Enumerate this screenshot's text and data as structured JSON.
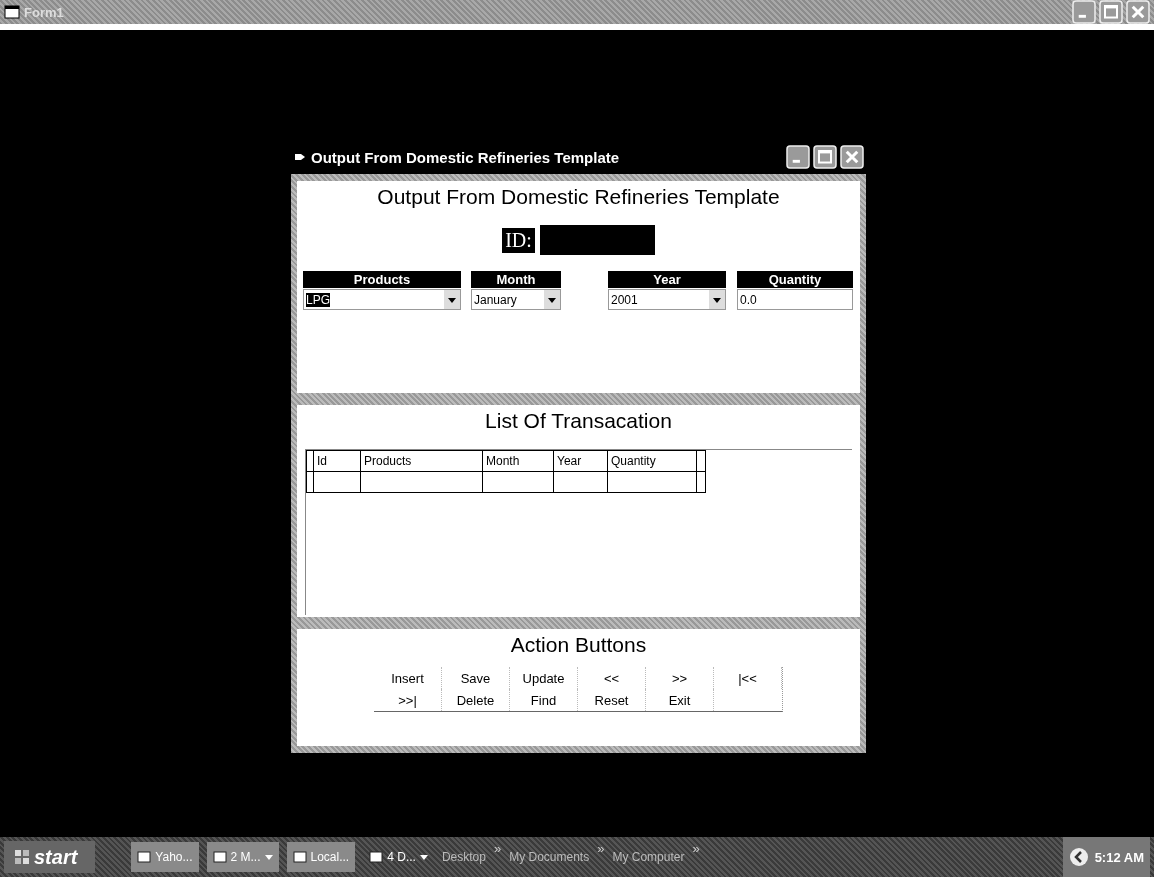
{
  "outer_window": {
    "title": "Form1"
  },
  "window": {
    "title": "Output From Domestic Refineries Template"
  },
  "header": {
    "title": "Output From Domestic Refineries Template",
    "id_label": "ID:"
  },
  "fields": [
    {
      "label": "Products",
      "value": "LPG",
      "kind": "dropdown",
      "text_selected": true
    },
    {
      "label": "Month",
      "value": "January",
      "kind": "dropdown",
      "text_selected": false
    },
    {
      "label": "Year",
      "value": "2001",
      "kind": "dropdown",
      "text_selected": false
    },
    {
      "label": "Quantity",
      "value": "0.0",
      "kind": "textbox",
      "text_selected": false
    }
  ],
  "list": {
    "title": "List Of Transacation",
    "columns": [
      "Id",
      "Products",
      "Month",
      "Year",
      "Quantity"
    ]
  },
  "actions": {
    "title": "Action Buttons",
    "rows": [
      [
        "Insert",
        "Save",
        "Update",
        "<<",
        ">>",
        "|<<"
      ],
      [
        ">>|",
        "Delete",
        "Find",
        "Reset",
        "Exit"
      ]
    ]
  },
  "taskbar": {
    "start": "start",
    "items": [
      {
        "label": "Yaho...",
        "dropdown": false
      },
      {
        "label": "2 M...",
        "dropdown": true
      },
      {
        "label": "Local...",
        "dropdown": false
      },
      {
        "label": "4 D...",
        "dropdown": true
      }
    ],
    "toolbars": [
      {
        "label": "Desktop",
        "chevron": "»"
      },
      {
        "label": "My Documents",
        "chevron": "»"
      },
      {
        "label": "My Computer",
        "chevron": "»"
      }
    ],
    "clock": "5:12 AM"
  }
}
